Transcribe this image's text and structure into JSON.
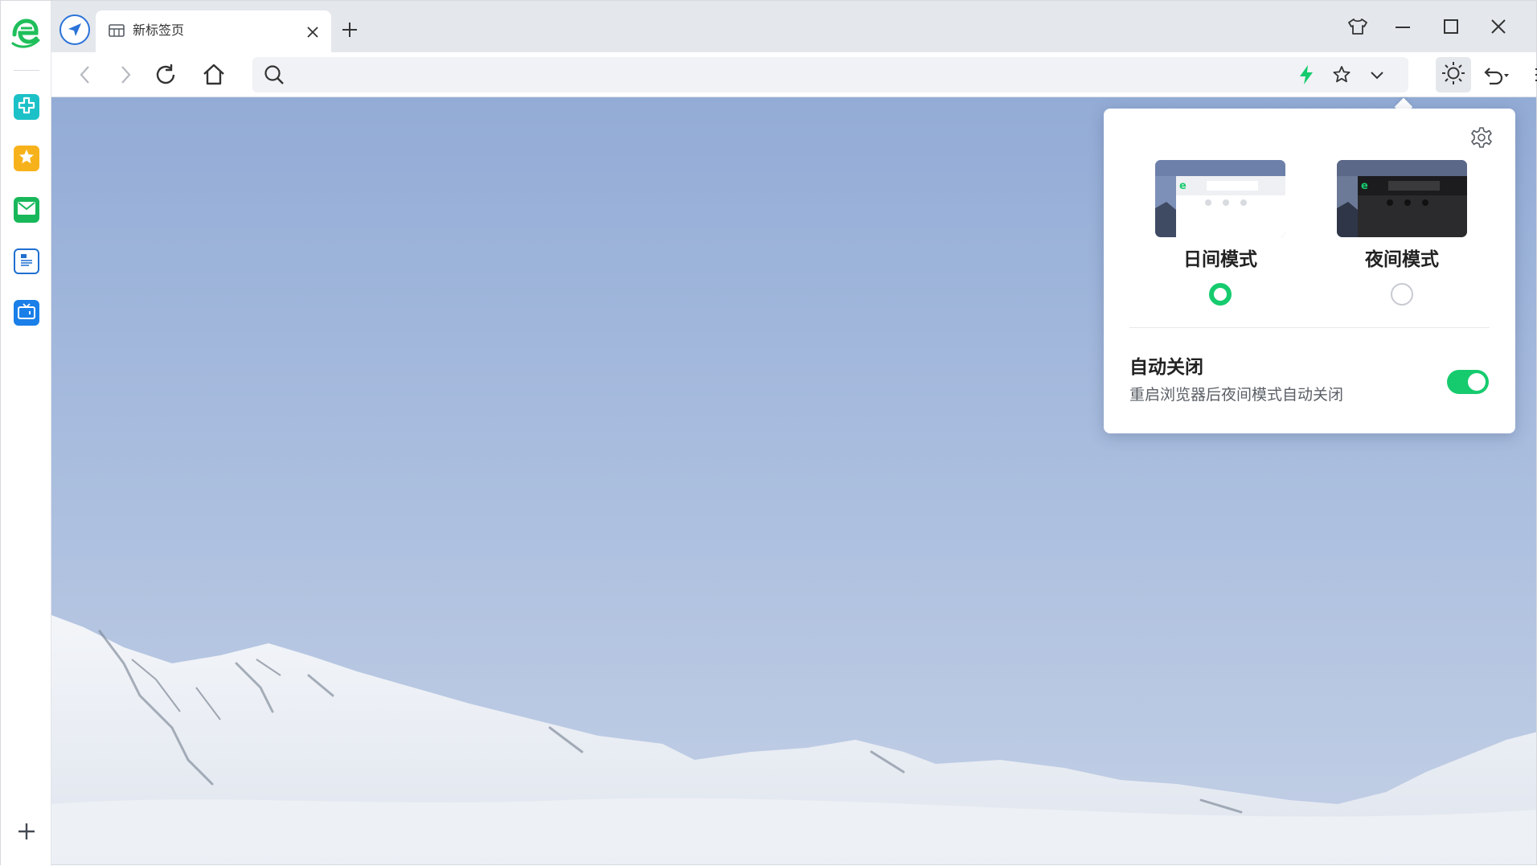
{
  "tab": {
    "title": "新标签页"
  },
  "address_bar": {
    "value": "",
    "placeholder": ""
  },
  "theme_popup": {
    "day_mode": {
      "label": "日间模式",
      "selected": true
    },
    "night_mode": {
      "label": "夜间模式",
      "selected": false
    },
    "auto_close": {
      "title": "自动关闭",
      "description": "重启浏览器后夜间模式自动关闭",
      "enabled": true
    }
  },
  "icons": {
    "sidebar": [
      "browser-logo-icon",
      "medical-cross-icon",
      "favorites-star-icon",
      "mail-icon",
      "news-icon",
      "tv-icon",
      "add-icon"
    ],
    "tab_strip": [
      "navigation-compass-icon",
      "tab-page-icon",
      "tab-close-icon",
      "new-tab-plus-icon",
      "skin-shirt-icon",
      "minimize-icon",
      "maximize-icon",
      "close-window-icon"
    ],
    "toolbar": [
      "back-arrow-icon",
      "forward-arrow-icon",
      "reload-icon",
      "home-icon",
      "search-icon",
      "lightning-speed-icon",
      "bookmark-star-icon",
      "dropdown-chevron-icon",
      "theme-sun-icon",
      "undo-close-tab-icon",
      "menu-icon"
    ]
  },
  "colors": {
    "accent_green": "#16cb6e",
    "brand_blue": "#2a73d9",
    "sky": "#a5badd",
    "tabstrip_bg": "#e4e7ec"
  }
}
